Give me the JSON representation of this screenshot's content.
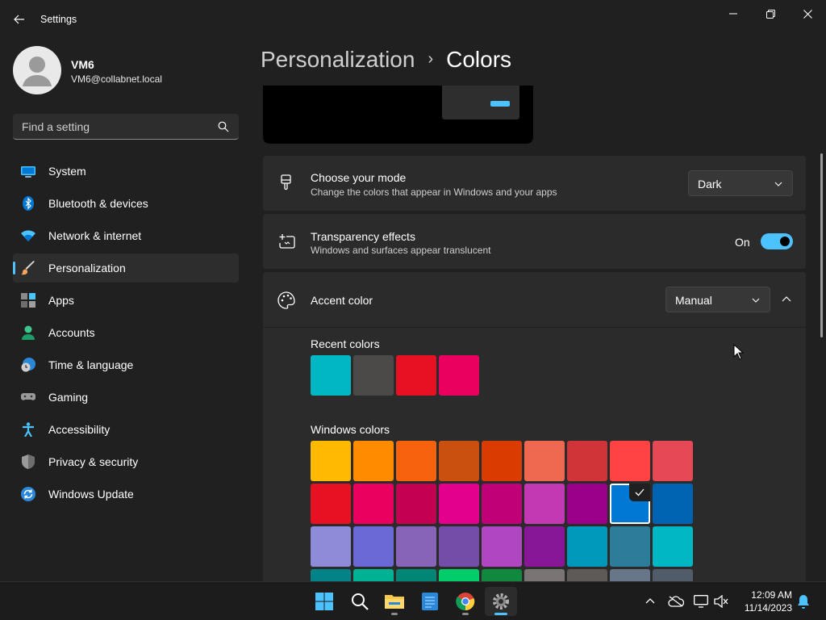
{
  "window": {
    "title": "Settings",
    "controls": {
      "minimize": "minimize-icon",
      "maximize": "restore-icon",
      "close": "close-icon"
    }
  },
  "user": {
    "name": "VM6",
    "email": "VM6@collabnet.local"
  },
  "search": {
    "placeholder": "Find a setting"
  },
  "sidebar": {
    "items": [
      {
        "label": "System",
        "icon": "system-icon"
      },
      {
        "label": "Bluetooth & devices",
        "icon": "bluetooth-icon"
      },
      {
        "label": "Network & internet",
        "icon": "wifi-icon"
      },
      {
        "label": "Personalization",
        "icon": "brush-icon",
        "active": true
      },
      {
        "label": "Apps",
        "icon": "apps-icon"
      },
      {
        "label": "Accounts",
        "icon": "accounts-icon"
      },
      {
        "label": "Time & language",
        "icon": "clock-globe-icon"
      },
      {
        "label": "Gaming",
        "icon": "gamepad-icon"
      },
      {
        "label": "Accessibility",
        "icon": "accessibility-icon"
      },
      {
        "label": "Privacy & security",
        "icon": "shield-icon"
      },
      {
        "label": "Windows Update",
        "icon": "update-icon"
      }
    ]
  },
  "breadcrumb": {
    "parent": "Personalization",
    "separator": "›",
    "current": "Colors"
  },
  "mode_card": {
    "title": "Choose your mode",
    "description": "Change the colors that appear in Windows and your apps",
    "value": "Dark"
  },
  "transparency_card": {
    "title": "Transparency effects",
    "description": "Windows and surfaces appear translucent",
    "state_label": "On",
    "enabled": true
  },
  "accent_card": {
    "title": "Accent color",
    "value": "Manual",
    "expanded": true,
    "recent_label": "Recent colors",
    "recent_colors": [
      "#00b7c3",
      "#4c4a48",
      "#e81123",
      "#ea005e"
    ],
    "windows_label": "Windows colors",
    "windows_colors": [
      [
        "#ffb900",
        "#ff8c00",
        "#f7630c",
        "#ca5010",
        "#da3b01",
        "#ef6950",
        "#d13438",
        "#ff4343",
        "#e74856"
      ],
      [
        "#e81123",
        "#ea005e",
        "#c30052",
        "#e3008c",
        "#bf0077",
        "#c239b3",
        "#9a0089",
        "#0078d4",
        "#0063b1"
      ],
      [
        "#8e8cd8",
        "#6b69d6",
        "#8764b8",
        "#744da9",
        "#b146c2",
        "#881798",
        "#0099bc",
        "#2d7d9a",
        "#00b7c3"
      ],
      [
        "#038387",
        "#00b294",
        "#018574",
        "#00cc6a",
        "#10893e",
        "#7a7574",
        "#5d5a58",
        "#68768a",
        "#515c6b"
      ]
    ],
    "selected": "#0078d4"
  },
  "colors": {
    "accent": "#4cc2ff",
    "background": "#202020",
    "card": "#2b2b2b"
  },
  "taskbar": {
    "apps": [
      "windows-start-icon",
      "search-icon",
      "file-explorer-icon",
      "notepad-icon",
      "chrome-icon",
      "settings-gear-icon"
    ],
    "tray": [
      "chevron-up-icon",
      "onedrive-icon",
      "display-icon",
      "volume-muted-icon",
      "notification-bell-icon"
    ],
    "time": "12:09 AM",
    "date": "11/14/2023"
  }
}
